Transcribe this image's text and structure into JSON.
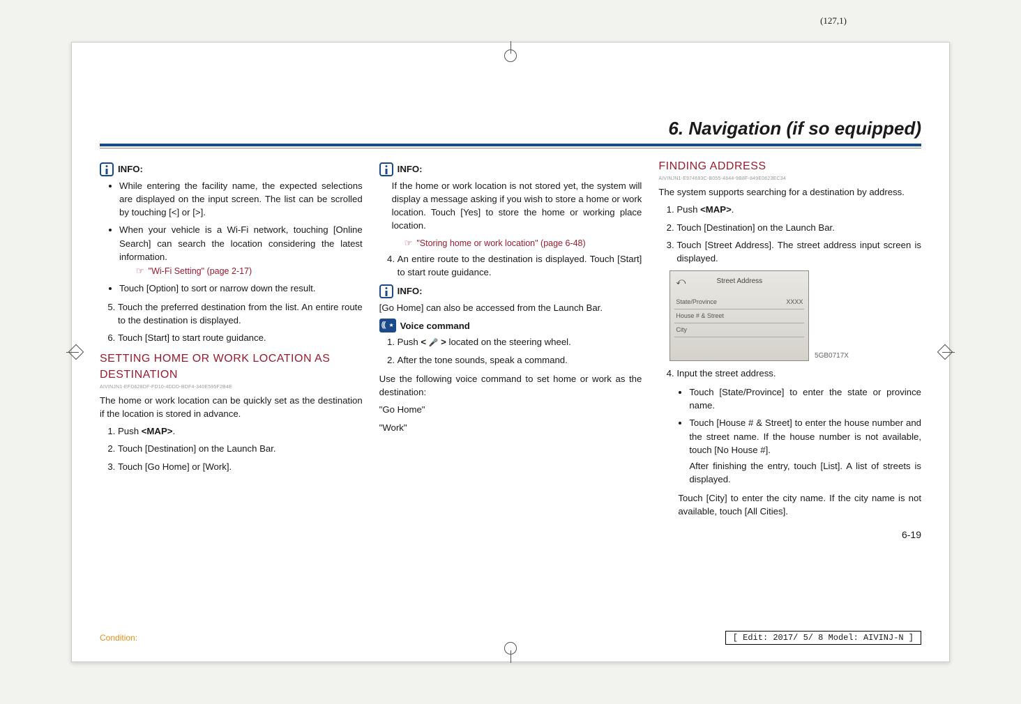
{
  "meta": {
    "coord": "(127,1)",
    "condition_label": "Condition:",
    "edit_box": "[ Edit: 2017/ 5/ 8   Model:  AIVINJ-N ]",
    "page_num": "6-19"
  },
  "header": {
    "title": "6. Navigation (if so equipped)"
  },
  "labels": {
    "info": "INFO:",
    "voice": "Voice command"
  },
  "col1": {
    "bullets1_a": "While entering the facility name, the expected selections are displayed on the input screen. The list can be scrolled by touching [<] or [>].",
    "bullets1_b": "When your vehicle is a Wi-Fi network, touching [Online Search] can search the location considering the latest information.",
    "ref1": "\"Wi-Fi Setting\" (page 2-17)",
    "bullets1_c": "Touch [Option] to sort or narrow down the result.",
    "step5": "Touch the preferred destination from the list. An entire route to the destination is displayed.",
    "step6": "Touch [Start] to start route guidance.",
    "section_head": "SETTING HOME OR WORK LOCATION AS DESTINATION",
    "guid": "AIVINJN1-EFD628DF-FD10-4DDD-BDF4-340E595F2B4E",
    "para": "The home or work location can be quickly set as the destination if the location is stored in advance.",
    "s1": "Push <MAP>.",
    "s2": "Touch [Destination] on the Launch Bar.",
    "s3": "Touch [Go Home] or [Work]."
  },
  "col2": {
    "info1_para": "If the home or work location is not stored yet, the system will display a message asking if you wish to store a home or work location. Touch [Yes] to store the home or working place location.",
    "ref1": "\"Storing home or work location\" (page 6-48)",
    "step4": "An entire route to the destination is displayed. Touch [Start] to start route guidance.",
    "info2_para": "[Go Home] can also be accessed from the Launch Bar.",
    "vc_s1_a": "Push ",
    "vc_s1_b": " located on the steering wheel.",
    "vc_s2": "After the tone sounds, speak a command.",
    "vc_para": "Use the following voice command to set home or work as the destination:",
    "vc_cmd1": "\"Go Home\"",
    "vc_cmd2": "\"Work\""
  },
  "col3": {
    "section_head": "FINDING ADDRESS",
    "guid": "AIVINJN1-E974693C-B055-4844-9B8F-849E0623EC34",
    "para": "The system supports searching for a destination by address.",
    "s1": "Push <MAP>.",
    "s2": "Touch [Destination] on the Launch Bar.",
    "s3": "Touch [Street Address]. The street address input screen is displayed.",
    "shot": {
      "title": "Street Address",
      "row1_l": "State/Province",
      "row1_r": "XXXX",
      "row2": "House # & Street",
      "row3": "City",
      "label": "5GB0717X"
    },
    "s4": "Input the street address.",
    "b1": "Touch [State/Province] to enter the state or province name.",
    "b2": "Touch [House # & Street] to enter the house number and the street name. If the house number is not available, touch [No House #].",
    "b2b": "After finishing the entry, touch [List]. A list of streets is displayed.",
    "b3": "Touch [City] to enter the city name. If the city name is not available, touch [All Cities]."
  }
}
